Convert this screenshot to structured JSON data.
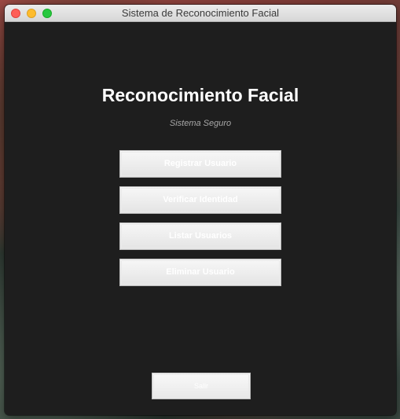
{
  "window": {
    "title": "Sistema de Reconocimiento Facial",
    "controls": [
      "close",
      "minimize",
      "zoom"
    ]
  },
  "main": {
    "heading": "Reconocimiento Facial",
    "subheading": "Sistema Seguro",
    "buttons": [
      {
        "label": "Registrar Usuario"
      },
      {
        "label": "Verificar Identidad"
      },
      {
        "label": "Listar Usuarios"
      },
      {
        "label": "Eliminar Usuario"
      }
    ],
    "exit_label": "Salir"
  },
  "colors": {
    "window_background": "#1e1e1e",
    "heading_text": "#ffffff",
    "subheading_text": "#a8a8a8",
    "button_face": "#eeeeee",
    "button_text": "#ffffff",
    "close": "#fe5f57",
    "minimize": "#febc2e",
    "zoom": "#28c840"
  }
}
